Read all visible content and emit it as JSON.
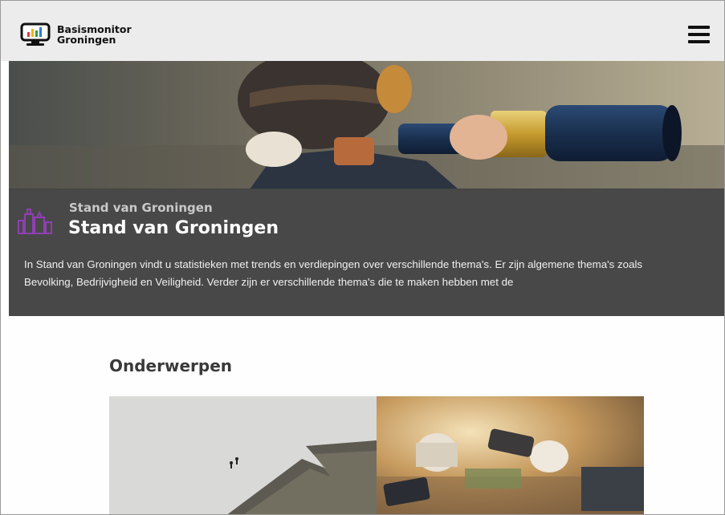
{
  "header": {
    "brand_line1": "Basismonitor",
    "brand_line2": "Groningen",
    "logo_icon": "monitor-bar-chart-icon",
    "menu_icon": "hamburger-menu-icon"
  },
  "hero": {
    "image": "child-with-telescope-photo",
    "icon": "theme-icon",
    "subtitle": "Stand van Groningen",
    "title": "Stand van Groningen",
    "description": "In Stand van Groningen vindt u statistieken met trends en verdiepingen over verschillende thema's. Er zijn algemene thema's zoals Bevolking, Bedrijvigheid en Veiligheid. Verder zijn er verschillende thema's die te maken hebben met de"
  },
  "topics": {
    "heading": "Onderwerpen",
    "tiles": [
      {
        "image": "crowd-arrow-photo"
      },
      {
        "image": "desk-coffee-phone-photo"
      }
    ]
  },
  "colors": {
    "header_bg": "#ececec",
    "hero_panel_bg": "#424242",
    "accent_purple": "#7a3a9a",
    "heading_text": "#3a3a3a"
  }
}
